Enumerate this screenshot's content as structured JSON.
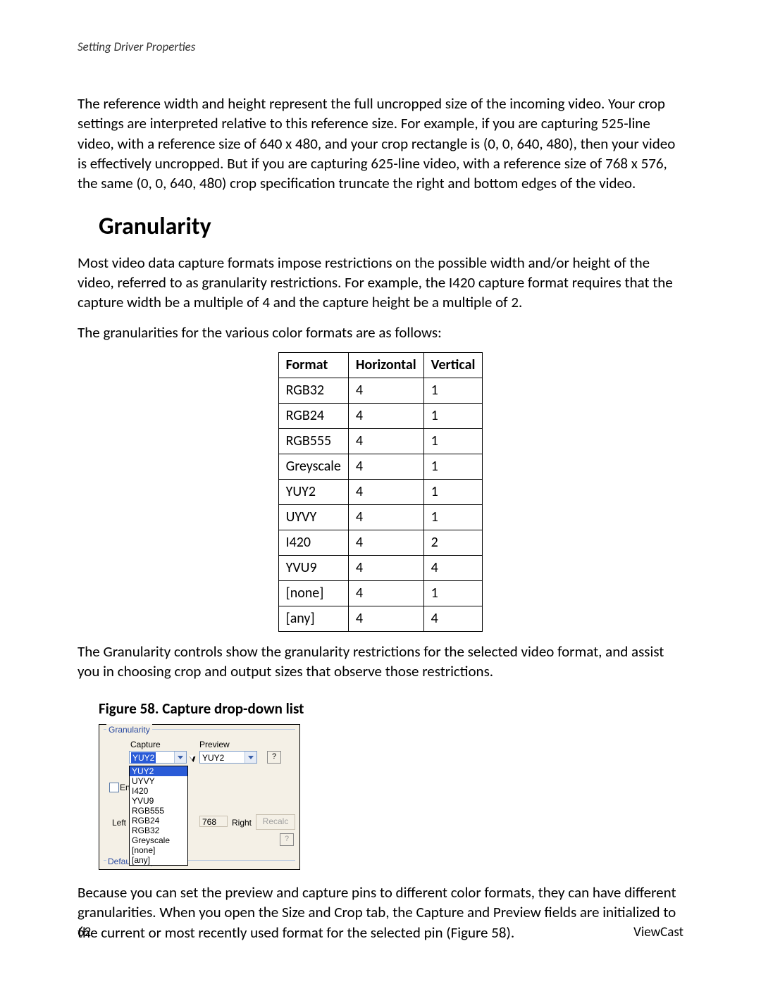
{
  "header": {
    "running": "Setting Driver Properties"
  },
  "para1": "The reference width and height represent the full uncropped size of the incoming video. Your crop settings are interpreted relative to this reference size. For example, if you are capturing 525-line video, with a reference size of 640 x 480, and your crop rectangle is (0, 0, 640, 480), then your video is effectively uncropped. But if you are capturing 625-line video, with a reference size of 768 x 576, the same (0, 0, 640, 480) crop specification truncate the right and bottom edges of the video.",
  "section_title": "Granularity",
  "para2": "Most video data capture formats impose restrictions on the possible width and/or height of the video, referred to as granularity restrictions. For example, the I420 capture format requires that the capture width be a multiple of 4 and the capture height be a multiple of 2.",
  "para3": "The granularities for the various color formats are as follows:",
  "table": {
    "headers": [
      "Format",
      "Horizontal",
      "Vertical"
    ],
    "rows": [
      [
        "RGB32",
        "4",
        "1"
      ],
      [
        "RGB24",
        "4",
        "1"
      ],
      [
        "RGB555",
        "4",
        "1"
      ],
      [
        "Greyscale",
        "4",
        "1"
      ],
      [
        "YUY2",
        "4",
        "1"
      ],
      [
        "UYVY",
        "4",
        "1"
      ],
      [
        "I420",
        "4",
        "2"
      ],
      [
        "YVU9",
        "4",
        "4"
      ],
      [
        "[none]",
        "4",
        "1"
      ],
      [
        "[any]",
        "4",
        "4"
      ]
    ]
  },
  "para4": "The Granularity controls show the granularity restrictions for the selected video format, and assist you in choosing crop and output sizes that observe those restrictions.",
  "figcaption": "Figure 58. Capture drop-down list",
  "shot": {
    "group_title": "Granularity",
    "capture_label": "Capture",
    "preview_label": "Preview",
    "capture_value": "YUY2",
    "preview_value": "YUY2",
    "help_label": "?",
    "dropdown_items": [
      "YUY2",
      "UYVY",
      "I420",
      "YVU9",
      "RGB555",
      "RGB24",
      "RGB32",
      "Greyscale",
      "[none]",
      "[any]"
    ],
    "enable_prefix": "En",
    "left_label": "Left",
    "val_768": "768",
    "right_label": "Right",
    "recalc_label": "Recalc",
    "default_label": "Default Output Size"
  },
  "para5": "Because you can set the preview and capture pins to different color formats, they can have different granularities. When you open the Size and Crop tab, the Capture and Preview fields are initialized to the current or most recently used format for the selected pin (Figure 58).",
  "footer": {
    "page": "62",
    "brand": "ViewCast"
  }
}
